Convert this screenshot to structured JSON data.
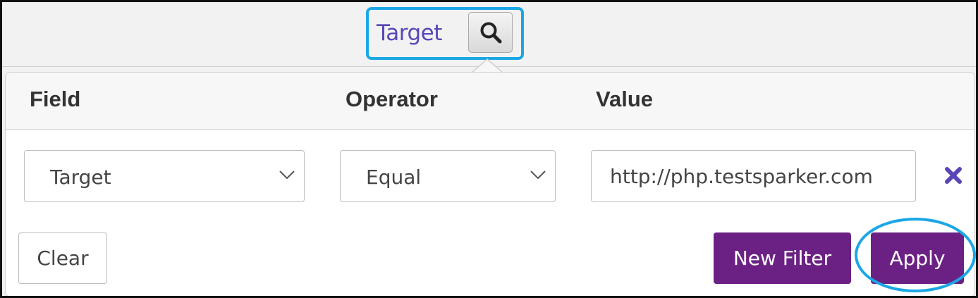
{
  "header": {
    "column_title": "Target",
    "search_icon": "search-icon"
  },
  "filter": {
    "headers": {
      "field": "Field",
      "operator": "Operator",
      "value": "Value"
    },
    "row": {
      "field_selected": "Target",
      "operator_selected": "Equal",
      "value": "http://php.testsparker.com",
      "remove_icon": "close-icon"
    },
    "buttons": {
      "clear": "Clear",
      "new_filter": "New Filter",
      "apply": "Apply"
    }
  },
  "colors": {
    "brand_purple": "#6b2184",
    "link_purple": "#5a45b8",
    "highlight_blue": "#1ba7e6"
  }
}
